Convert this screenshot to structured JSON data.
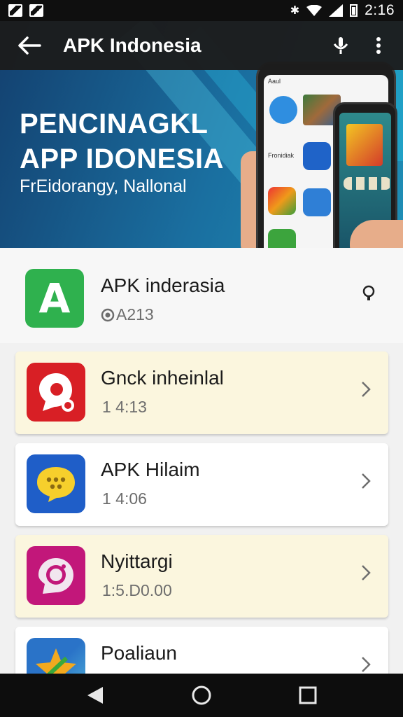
{
  "status_bar": {
    "time": "2:16"
  },
  "app_bar": {
    "title": "APK Indonesia"
  },
  "hero": {
    "headline_line1": "PENCINAGKL",
    "headline_line2": "APP IDONESIA",
    "subtitle": "FrEidorangy, Nallonal",
    "phone_label_1": "Aaul",
    "phone_label_2": "Fronidiak"
  },
  "header_item": {
    "title": "APK inderasia",
    "meta": "A213",
    "icon_letter": "A"
  },
  "items": [
    {
      "title": "Gnck inheinlal",
      "meta": "1 4:13",
      "highlight": true
    },
    {
      "title": "APK Hilaim",
      "meta": "1 4:06",
      "highlight": false
    },
    {
      "title": "Nyittargi",
      "meta": "1:5.D0.00",
      "highlight": true
    },
    {
      "title": "Poaliaun",
      "meta": "",
      "highlight": false
    }
  ],
  "colors": {
    "status_bar": "#0f0f0f",
    "app_bar": "#1c1c1c",
    "hero_start": "#13406f",
    "hero_end": "#1f8fb6",
    "apk_green": "#2fb14e",
    "red_app": "#d81f25",
    "blue_app": "#1f5ec8",
    "pink_app": "#c2177a",
    "highlight_card": "#fbf6de",
    "nav_bar": "#0d0d0d"
  },
  "icons": {
    "back": "arrow-left-icon",
    "mic": "mic-icon",
    "more": "more-vert-icon",
    "bulb": "lightbulb-icon",
    "chevron": "chevron-right-icon",
    "nav_back": "triangle-back-icon",
    "nav_home": "circle-home-icon",
    "nav_recents": "square-recents-icon"
  }
}
